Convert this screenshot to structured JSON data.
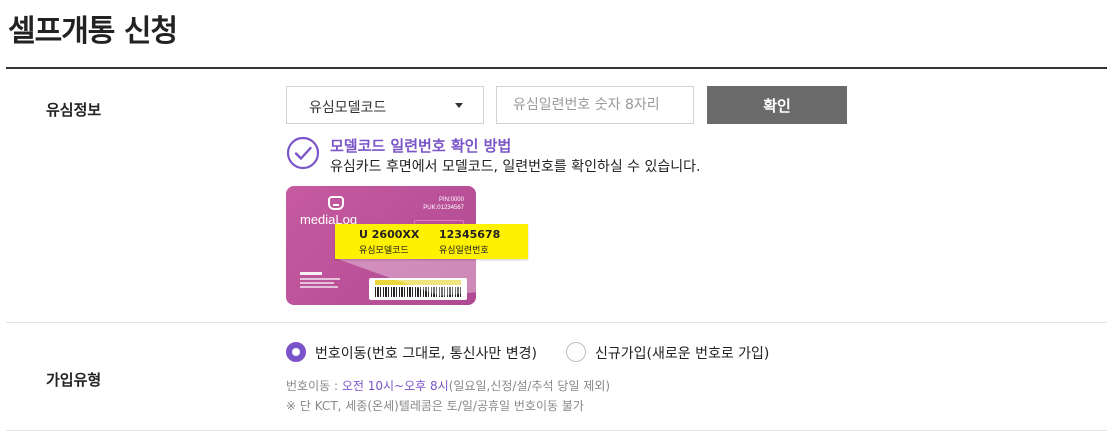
{
  "page": {
    "title": "셀프개통 신청"
  },
  "sim_info": {
    "label": "유심정보",
    "model_select": {
      "selected": "유심모델코드"
    },
    "serial_input": {
      "placeholder": "유심일련번호 숫자 8자리",
      "value": ""
    },
    "confirm_label": "확인",
    "howto_title": "모델코드 일련번호 확인 방법",
    "howto_desc": "유심카드 후면에서 모델코드, 일련번호를 확인하실 수 있습니다.",
    "card": {
      "brand": "mediaLog",
      "pin": "PIN:0000",
      "puk": "PUK:01234567",
      "zoom": {
        "model_value": "U 2600XX",
        "model_caption": "유심모델코드",
        "serial_value": "12345678",
        "serial_caption": "유심일련번호"
      }
    }
  },
  "join_type": {
    "label": "가입유형",
    "options": [
      {
        "label": "번호이동(번호 그대로, 통신사만 변경)",
        "selected": true
      },
      {
        "label": "신규가입(새로운 번호로 가입)",
        "selected": false
      }
    ],
    "note_prefix": "번호이동 : ",
    "note_highlight": "오전 10시~오후 8시",
    "note_suffix": "(일요일,신정/설/추석 당일 제외)",
    "note2": "※ 단 KCT, 세종(온세)텔레콤은 토/일/공휴일 번호이동 불가"
  },
  "colors": {
    "accent": "#7b55c7",
    "button": "#6b6b6b",
    "card": "#c75aa0",
    "highlight": "#fff200"
  }
}
